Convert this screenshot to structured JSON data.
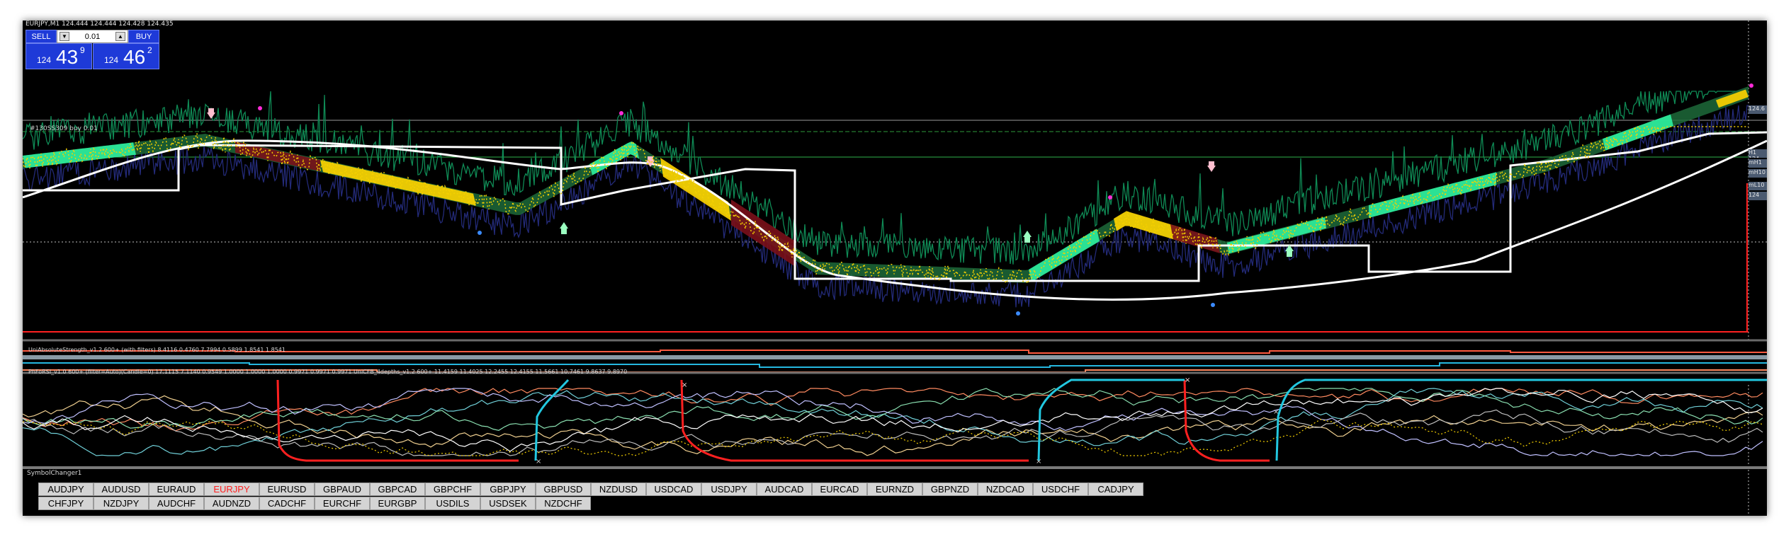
{
  "window": {
    "title": "EURJPY,M1  124.444 124.444 124.428 124.435"
  },
  "trade_panel": {
    "sell_label": "SELL",
    "buy_label": "BUY",
    "lot_value": "0.01",
    "sell_quote": {
      "prefix": "124",
      "big": "43",
      "sup": "9"
    },
    "buy_quote": {
      "prefix": "124",
      "big": "46",
      "sup": "2"
    }
  },
  "order_line_label": "#130SS309 buy 0.01",
  "indicators": {
    "sub1_label": "UniAbsoluteStrength_v1.2 600+ (with filters) 8.4116 0.4760 7.7994 0.5899 1.8541 1.8541",
    "sub2_label": "PhFoRSI_v1.0 600+ (filter=Auto)(Candle=0) 17.1115 7.1140 0.9549 1.0000 1.0000 1.0000 0.9971 0.9971 0.9971   UniCFB_4depths_v1.2  600+ 11.4159 11.4025 12.2455 12.4155 11.5661 10.7461 9.8637 9.8970"
  },
  "price_tags": [
    "124.6",
    "H1 124",
    "mH1",
    "mH10",
    "mL10",
    "124"
  ],
  "symbol_changer": {
    "title": "SymbolChanger1",
    "active": "EURJPY",
    "row1": [
      "AUDJPY",
      "AUDUSD",
      "EURAUD",
      "EURJPY",
      "EURUSD",
      "GBPAUD",
      "GBPCAD",
      "GBPCHF",
      "GBPJPY",
      "GBPUSD",
      "NZDUSD",
      "USDCAD",
      "USDJPY",
      "AUDCAD",
      "EURCAD",
      "EURNZD",
      "GBPNZD",
      "NZDCAD",
      "USDCHF",
      "CADJPY"
    ],
    "row2": [
      "CHFJPY",
      "NZDJPY",
      "AUDCHF",
      "AUDNZD",
      "CADCHF",
      "EURCHF",
      "EURGBP",
      "USDILS",
      "USDSEK",
      "NZDCHF"
    ]
  },
  "colors": {
    "background": "#000000",
    "price_line": "#0f8a55",
    "white_band": "#ffffff",
    "ribbon_bull": "#2df0a0",
    "ribbon_bear": "#7a0f1a",
    "ribbon_yellow": "#ffd400",
    "cyan_line": "#22c8e0",
    "red_line": "#ff2020",
    "button_blue": "#1e3ad8"
  }
}
